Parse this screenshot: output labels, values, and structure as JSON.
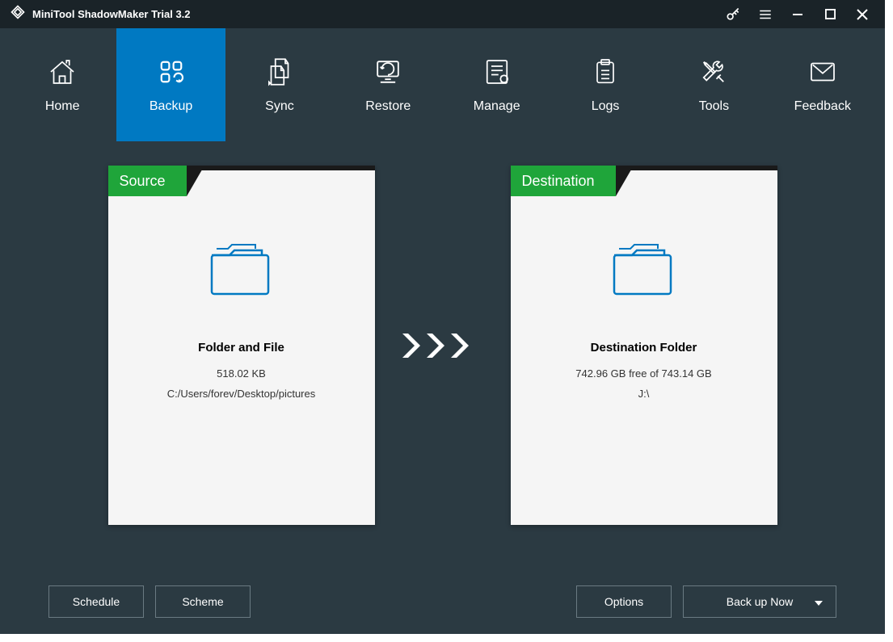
{
  "app": {
    "title": "MiniTool ShadowMaker Trial 3.2"
  },
  "nav": {
    "items": [
      {
        "label": "Home"
      },
      {
        "label": "Backup"
      },
      {
        "label": "Sync"
      },
      {
        "label": "Restore"
      },
      {
        "label": "Manage"
      },
      {
        "label": "Logs"
      },
      {
        "label": "Tools"
      },
      {
        "label": "Feedback"
      }
    ],
    "active_index": 1
  },
  "source": {
    "header": "Source",
    "title": "Folder and File",
    "size": "518.02 KB",
    "path": "C:/Users/forev/Desktop/pictures"
  },
  "destination": {
    "header": "Destination",
    "title": "Destination Folder",
    "space": "742.96 GB free of 743.14 GB",
    "path": "J:\\"
  },
  "buttons": {
    "schedule": "Schedule",
    "scheme": "Scheme",
    "options": "Options",
    "backup_now": "Back up Now"
  }
}
